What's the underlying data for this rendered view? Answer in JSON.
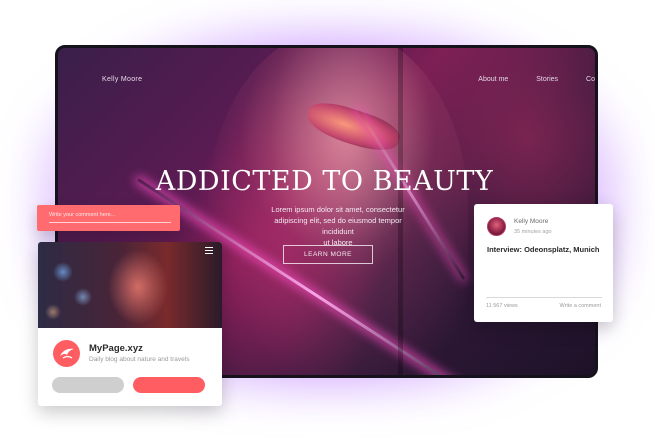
{
  "hero": {
    "nav_name": "Kelly Moore",
    "nav_links": [
      "About me",
      "Stories",
      "Co"
    ],
    "title": "ADDICTED TO BEAUTY",
    "text_line1": "Lorem ipsum dolor sit amet, consectetur",
    "text_line2": "adipiscing elit, sed do eiusmod tempor incididunt",
    "text_line3": "ut labore",
    "button_label": "LEARN MORE"
  },
  "comment_input": {
    "placeholder": "Write your comment here..."
  },
  "mobile_card": {
    "site_name": "MyPage.xyz",
    "tagline": "Daily blog about nature and travels"
  },
  "post_card": {
    "author": "Kelly Moore",
    "posted": "35 minutes ago",
    "title": "Interview: Odeonsplatz, Munich",
    "views": "11 567 views",
    "action": "Write a comment"
  },
  "colors": {
    "accent": "#ff5d62",
    "glow": "#b06bff",
    "frame": "#15121c"
  }
}
